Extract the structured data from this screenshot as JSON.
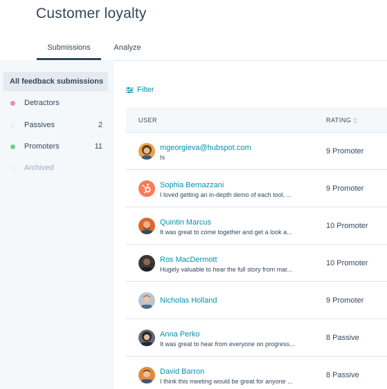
{
  "page": {
    "title": "Customer loyalty"
  },
  "tabs": [
    {
      "label": "Submissions",
      "active": true
    },
    {
      "label": "Analyze",
      "active": false
    }
  ],
  "sidebar": {
    "items": [
      {
        "label": "All feedback submissions",
        "count": "",
        "dot_color": "",
        "active": true
      },
      {
        "label": "Detractors",
        "count": "",
        "dot_color": "#e68eae"
      },
      {
        "label": "Passives",
        "count": "2",
        "dot_color": "#eaf0f6"
      },
      {
        "label": "Promoters",
        "count": "11",
        "dot_color": "#6fd18a"
      },
      {
        "label": "Archived",
        "count": "",
        "dot_color": "#ffffff"
      }
    ]
  },
  "filter": {
    "label": "Filter",
    "icon": "filter-sliders-icon"
  },
  "table": {
    "columns": {
      "user": "USER",
      "rating": "RATING"
    },
    "rows": [
      {
        "name": "mgeorgieva@hubspot.com",
        "comment": "hi",
        "rating": "9 Promoter",
        "avatar": "photo-woman-curly"
      },
      {
        "name": "Sophia Bernazzani",
        "comment": "I loved getting an in-depth demo of each tool, ...",
        "rating": "9 Promoter",
        "avatar": "hubspot-logo"
      },
      {
        "name": "Quintin Marcus",
        "comment": "It was great to come together and get a look a...",
        "rating": "10 Promoter",
        "avatar": "photo-man-beard"
      },
      {
        "name": "Ros MacDermott",
        "comment": "Hugely valuable to hear the full story from mar...",
        "rating": "10 Promoter",
        "avatar": "photo-man-dark"
      },
      {
        "name": "Nicholas Holland",
        "comment": "",
        "rating": "9 Promoter",
        "avatar": "photo-man-light"
      },
      {
        "name": "Anna Perko",
        "comment": "It was great to hear from everyone on progress...",
        "rating": "8 Passive",
        "avatar": "photo-woman-dark"
      },
      {
        "name": "David Barron",
        "comment": "I think this meeting would be great for anyone ...",
        "rating": "8 Passive",
        "avatar": "photo-man-smile"
      }
    ]
  },
  "colors": {
    "link": "#0091ae",
    "text": "#33475b",
    "sidebar_bg": "#f5f8fa",
    "active_item_bg": "#e5eaf0",
    "hubspot_orange": "#ff7a59"
  }
}
